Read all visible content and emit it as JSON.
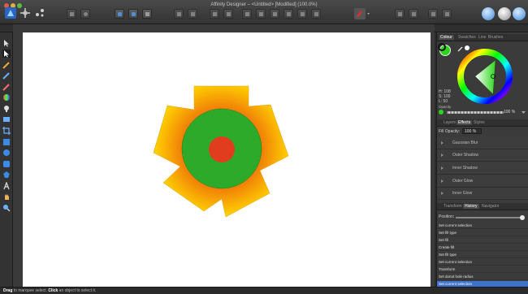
{
  "window": {
    "title": "Affinity Designer – <Untitled> [Modified] (100.0%)"
  },
  "colors": {
    "accent": "#3f72c9",
    "shape_gradient_center": "#e74c0e",
    "shape_gradient_edge": "#ffd000",
    "circle": "#2eaa2a",
    "inner": "#e23c1e"
  },
  "toolbar_icons": [
    "persona-designer-icon",
    "persona-pixel-icon",
    "persona-export-icon",
    "boolean-icon",
    "geometry-icon",
    "snapping-icon",
    "align-icon",
    "distribute-icon",
    "arrange-back-icon",
    "arrange-backward-icon",
    "arrange-forward-icon",
    "arrange-front-icon",
    "colour-picker-icon",
    "studio-icon"
  ],
  "tools": [
    "move-tool-icon",
    "node-tool-icon",
    "pencil-icon",
    "pen-icon",
    "vector-brush-icon",
    "fill-tool-icon",
    "transparency-icon",
    "place-image-icon",
    "crop-icon",
    "rectangle-icon",
    "ellipse-icon",
    "rounded-rect-icon",
    "shape-icon",
    "text-icon",
    "hand-icon",
    "zoom-icon"
  ],
  "colour_panel": {
    "tabs": [
      "Colour",
      "Swatches",
      "Line",
      "Brushes"
    ],
    "hsl": {
      "h": "H: 108",
      "s": "S: 100",
      "l": "L: 50"
    },
    "opacity_label": "Opacity",
    "opacity_value": "100 %",
    "opacity": 1.0
  },
  "effects_panel": {
    "tabs": [
      "Layers",
      "Effects",
      "Styles"
    ],
    "fill_opacity_label": "Fill Opacity:",
    "fill_opacity_value": "100 %",
    "effects": [
      "Gaussian Blur",
      "Outer Shadow",
      "Inner Shadow",
      "Outer Glow",
      "Inner Glow"
    ]
  },
  "history_panel": {
    "tabs": [
      "Transform",
      "History",
      "Navigator"
    ],
    "position_label": "Position:",
    "position_fraction": 1.0,
    "items": [
      "Set current selection",
      "Set fill type",
      "Set fill",
      "Create fill",
      "Set fill type",
      "Set current selection",
      "Transform",
      "Set donut hole radius",
      "Set current selection"
    ],
    "selected_index": 8
  },
  "status": {
    "drag": "Drag",
    "drag_text": "to marquee select.",
    "click": "Click",
    "click_text": "an object to select it."
  }
}
